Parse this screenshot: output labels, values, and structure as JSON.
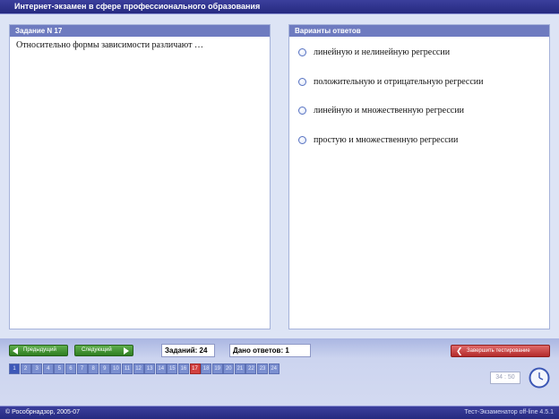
{
  "app": {
    "title": "Интернет-экзамен в сфере профессионального образования"
  },
  "question_panel": {
    "header": "Задание N 17",
    "text": "Относительно формы зависимости различают …"
  },
  "answers_panel": {
    "header": "Варианты ответов",
    "options": [
      "линейную и нелинейную регрессии",
      "положительную и отрицательную регрессии",
      "линейную и множественную регрессии",
      "простую и множественную регрессии"
    ]
  },
  "toolbar": {
    "prev_label": "Предыдущий",
    "next_label": "Следующий",
    "total_tasks": "Заданий: 24",
    "answered": "Дано ответов: 1",
    "finish_label": "Завершить тестирование"
  },
  "question_nav": {
    "numbers": [
      "1",
      "2",
      "3",
      "4",
      "5",
      "6",
      "7",
      "8",
      "9",
      "10",
      "11",
      "12",
      "13",
      "14",
      "15",
      "16",
      "17",
      "18",
      "19",
      "20",
      "21",
      "22",
      "23",
      "24"
    ],
    "current": "17",
    "answered": [
      "1"
    ]
  },
  "timer": "34 : 50",
  "status": {
    "copyright": "© Рособрнадзор, 2005-07",
    "version": "Тест-Экзаменатор off-line 4.5.1"
  },
  "colors": {
    "header_bar": "#2c308a",
    "panel_header": "#6e7bc0",
    "nav_button": "#3e8e2e",
    "finish_button": "#c43a3a",
    "current_question": "#d24040",
    "question_button": "#7b8fd0"
  }
}
